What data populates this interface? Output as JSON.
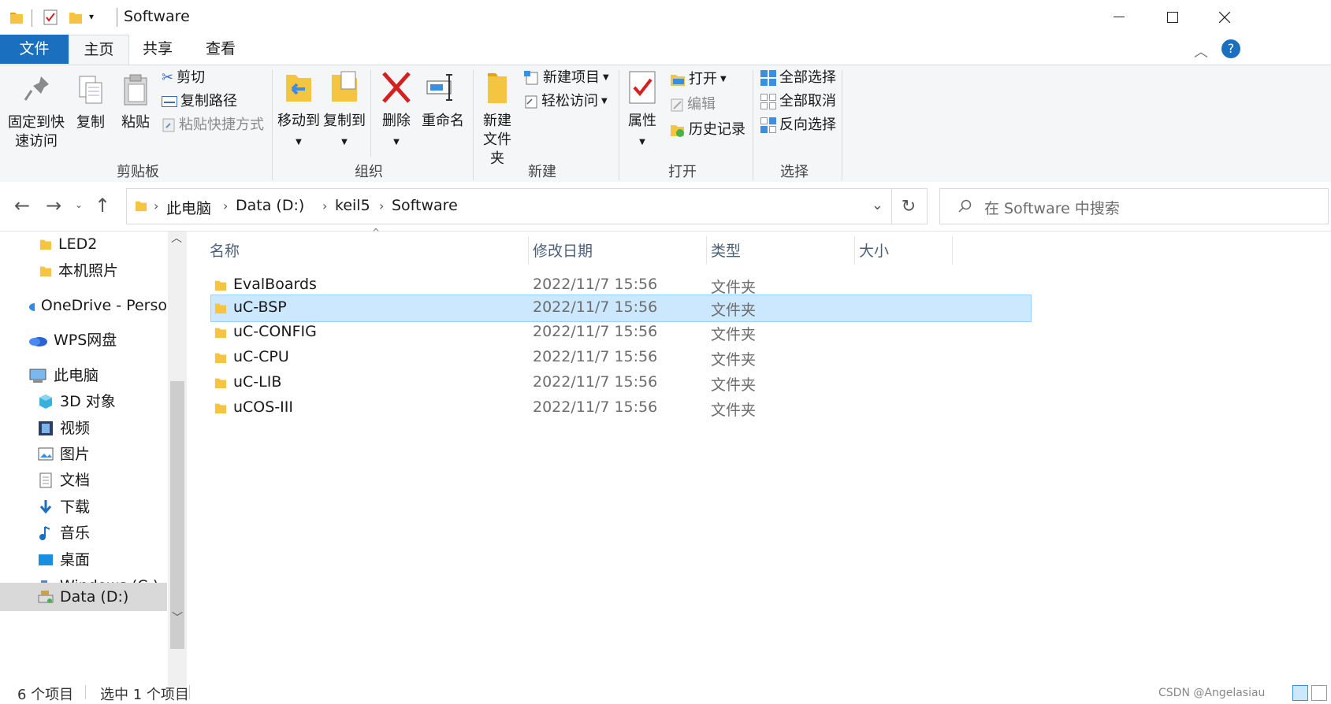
{
  "window": {
    "title": "Software"
  },
  "tabs": {
    "file": "文件",
    "home": "主页",
    "share": "共享",
    "view": "查看"
  },
  "ribbon": {
    "clipboard": {
      "label": "剪贴板",
      "pin": [
        "固定到快",
        "速访问"
      ],
      "copy": "复制",
      "paste": "粘贴",
      "cut": "剪切",
      "copy_path": "复制路径",
      "paste_shortcut": "粘贴快捷方式"
    },
    "organize": {
      "label": "组织",
      "move_to": "移动到",
      "copy_to": "复制到",
      "delete": "删除",
      "rename": "重命名"
    },
    "new": {
      "label": "新建",
      "new_folder": [
        "新建",
        "文件夹"
      ],
      "new_item": "新建项目",
      "easy_access": "轻松访问"
    },
    "open": {
      "label": "打开",
      "properties": "属性",
      "open": "打开",
      "edit": "编辑",
      "history": "历史记录"
    },
    "select": {
      "label": "选择",
      "select_all": "全部选择",
      "select_none": "全部取消",
      "invert": "反向选择"
    }
  },
  "address": {
    "crumbs": [
      "此电脑",
      "Data (D:)",
      "keil5",
      "Software"
    ],
    "search_placeholder": "在 Software 中搜索"
  },
  "nav": {
    "items": [
      {
        "label": "LED2",
        "icon": "folder-icon"
      },
      {
        "label": "本机照片",
        "icon": "folder-icon"
      },
      {
        "label": "OneDrive - Perso",
        "icon": "cloud-icon"
      },
      {
        "label": "WPS网盘",
        "icon": "cloud-icon"
      },
      {
        "label": "此电脑",
        "icon": "computer-icon"
      },
      {
        "label": "3D 对象",
        "icon": "cube-icon"
      },
      {
        "label": "视频",
        "icon": "video-icon"
      },
      {
        "label": "图片",
        "icon": "picture-icon"
      },
      {
        "label": "文档",
        "icon": "document-icon"
      },
      {
        "label": "下载",
        "icon": "download-icon"
      },
      {
        "label": "音乐",
        "icon": "music-icon"
      },
      {
        "label": "桌面",
        "icon": "desktop-icon"
      },
      {
        "label": "Windows (C:)",
        "icon": "drive-icon"
      },
      {
        "label": "Data (D:)",
        "icon": "drive-icon"
      }
    ]
  },
  "files": {
    "columns": {
      "name": "名称",
      "modified": "修改日期",
      "type": "类型",
      "size": "大小"
    },
    "rows": [
      {
        "name": "EvalBoards",
        "modified": "2022/11/7 15:56",
        "type": "文件夹",
        "selected": false
      },
      {
        "name": "uC-BSP",
        "modified": "2022/11/7 15:56",
        "type": "文件夹",
        "selected": true
      },
      {
        "name": "uC-CONFIG",
        "modified": "2022/11/7 15:56",
        "type": "文件夹",
        "selected": false
      },
      {
        "name": "uC-CPU",
        "modified": "2022/11/7 15:56",
        "type": "文件夹",
        "selected": false
      },
      {
        "name": "uC-LIB",
        "modified": "2022/11/7 15:56",
        "type": "文件夹",
        "selected": false
      },
      {
        "name": "uCOS-III",
        "modified": "2022/11/7 15:56",
        "type": "文件夹",
        "selected": false
      }
    ]
  },
  "status": {
    "count": "6 个项目",
    "selected": "选中 1 个项目",
    "watermark": "CSDN @Angelasiau"
  },
  "colors": {
    "accent": "#1a6fbf",
    "selection_bg": "#cce8ff",
    "folder": "#f5c542"
  }
}
